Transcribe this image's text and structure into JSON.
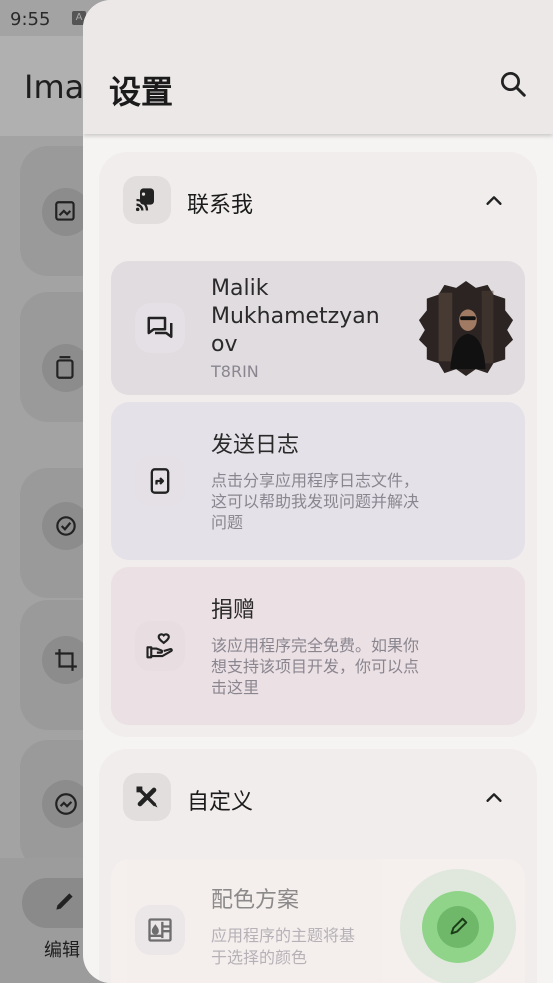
{
  "status_bar": {
    "time": "9:55"
  },
  "background_app": {
    "title": "Ima",
    "bottom_nav_label": "编辑"
  },
  "drawer": {
    "title": "设置",
    "sections": [
      {
        "label": "联系我",
        "items": [
          {
            "name_line1": "Malik",
            "name_line2": "Mukhametzyan",
            "name_line3": "ov",
            "handle": "T8RIN"
          },
          {
            "title": "发送日志",
            "subtitle_line1": "点击分享应用程序日志文件，",
            "subtitle_line2": "这可以帮助我发现问题并解决",
            "subtitle_line3": "问题"
          },
          {
            "title": "捐赠",
            "subtitle_line1": "该应用程序完全免费。如果你",
            "subtitle_line2": "想支持该项目开发，你可以点",
            "subtitle_line3": "击这里"
          }
        ]
      },
      {
        "label": "自定义",
        "items": [
          {
            "title": "配色方案",
            "subtitle_line1": "应用程序的主题将基",
            "subtitle_line2": "于选择的颜色"
          }
        ]
      }
    ]
  },
  "colors": {
    "drawer_bg": "#f6f3f3",
    "header_bg": "#ece8e7",
    "item_profile_bg": "#e0dcdf",
    "item_log_bg": "#e5e1e8",
    "item_donate_bg": "#ebe0e3",
    "fab": "#90d48a"
  },
  "icons": [
    "search-icon",
    "chevron-up-icon",
    "cast-icon",
    "chat-icon",
    "share-file-icon",
    "donate-hand-icon",
    "design-tools-icon",
    "palette-icon",
    "edit-pencil-icon"
  ]
}
